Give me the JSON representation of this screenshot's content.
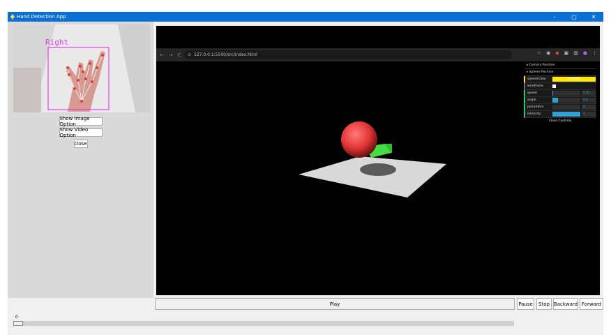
{
  "window": {
    "title": "Hand Detection App",
    "minimize": "–",
    "maximize": "▢",
    "close": "✕",
    "accent": "#0a6fd6"
  },
  "preview": {
    "label": "Right",
    "label_color": "#e040e0"
  },
  "left_buttons": {
    "show_image": "Show Image Option",
    "show_video": "Show Video Option",
    "close": "close"
  },
  "browser": {
    "back": "←",
    "forward": "→",
    "reload": "C",
    "url": "127.0.0.1:5500/src/index.html"
  },
  "gui": {
    "camera_folder": "▸ Camera Position",
    "sphere_folder": "▸ Sphere Position",
    "sphere_color_label": "sphereColor",
    "sphere_color_value": "#ffea00",
    "wireframe_label": "wireframe",
    "rows": [
      {
        "label": "speed",
        "value": "0.01",
        "fill": 0.02
      },
      {
        "label": "angle",
        "value": "0.2",
        "fill": 0.2
      },
      {
        "label": "penumbra",
        "value": "0",
        "fill": 0
      },
      {
        "label": "intensity",
        "value": "1",
        "fill": 1
      }
    ],
    "close_controls": "Close Controls"
  },
  "controls": {
    "play": "Play",
    "pause": "Pause",
    "stop": "Stop",
    "backward": "Backward",
    "forward": "Forward"
  },
  "scale": {
    "value": "0",
    "position": 0
  }
}
